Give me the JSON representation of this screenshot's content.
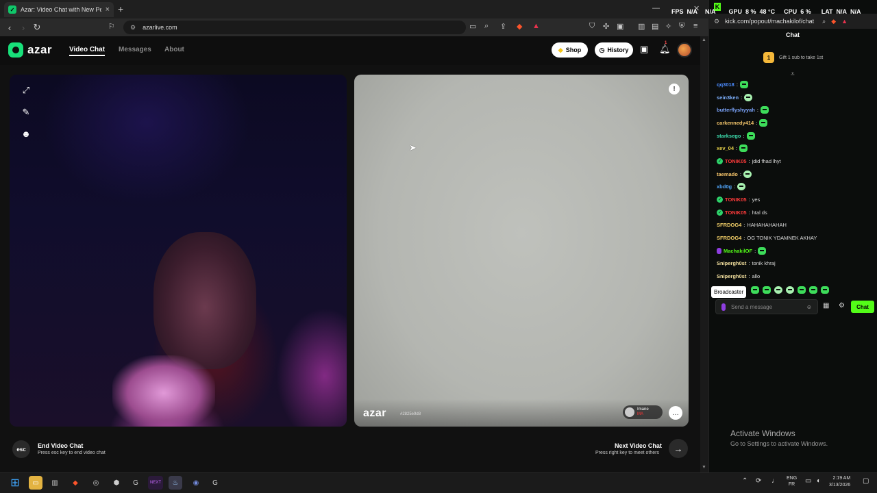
{
  "browser": {
    "tab_title": "Azar: Video Chat with New Pe",
    "url": "azarlive.com"
  },
  "azar": {
    "brand": "azar",
    "nav": [
      "Video Chat",
      "Messages",
      "About"
    ],
    "shop_label": "Shop",
    "history_label": "History",
    "notification_count": "1",
    "watermark": "azar",
    "watermark_id": "#2825e9d8",
    "peer_name": "Imane",
    "peer_country": "MA",
    "end_title": "End Video Chat",
    "end_sub": "Press esc key to end video chat",
    "esc_label": "esc",
    "next_title": "Next Video Chat",
    "next_sub": "Press right key to meet others"
  },
  "overlay": {
    "fps_label": "FPS",
    "fps_val": "N/A",
    "gpu_label": "GPU",
    "gpu_pct": "8 %",
    "gpu_temp": "48 °C",
    "cpu_label": "CPU",
    "cpu_pct": "6 %",
    "lat_label": "LAT",
    "lat_val1": "N/A",
    "lat_val2": "N/A"
  },
  "kick": {
    "url": "kick.com/popout/machakilof/chat",
    "chat_title": "Chat",
    "gift_text": "Gift 1 sub to take 1st",
    "gift_rank": "1",
    "messages": [
      {
        "user": "qq3018",
        "color": "#4d8cff",
        "badge": "",
        "text": "",
        "emote": "green"
      },
      {
        "user": "sein3ken",
        "color": "#7fb2ff",
        "badge": "",
        "text": "",
        "emote": "face"
      },
      {
        "user": "butterflyshyyah",
        "color": "#7da6ff",
        "badge": "",
        "text": "",
        "emote": "green"
      },
      {
        "user": "carkennedy414",
        "color": "#f2c46a",
        "badge": "",
        "text": "",
        "emote": "green"
      },
      {
        "user": "starksego",
        "color": "#3ee0b0",
        "badge": "",
        "text": "",
        "emote": "green"
      },
      {
        "user": "xev_04",
        "color": "#e8d34a",
        "badge": "",
        "text": "",
        "emote": "green"
      },
      {
        "user": "TONIK05",
        "color": "#ff3b3b",
        "badge": "check",
        "text": "jdid fhad lhyt",
        "emote": ""
      },
      {
        "user": "taemado",
        "color": "#f7c56b",
        "badge": "",
        "text": "",
        "emote": "face"
      },
      {
        "user": "xbd0g",
        "color": "#52a8ff",
        "badge": "",
        "text": "",
        "emote": "face"
      },
      {
        "user": "TONIK05",
        "color": "#ff3b3b",
        "badge": "check",
        "text": "yes",
        "emote": ""
      },
      {
        "user": "TONIK05",
        "color": "#ff3b3b",
        "badge": "check",
        "text": "htal ds",
        "emote": ""
      },
      {
        "user": "SFRDOG4",
        "color": "#f7d36a",
        "badge": "",
        "text": "HAHAHAHAHAH",
        "emote": ""
      },
      {
        "user": "SFRDOG4",
        "color": "#f7d36a",
        "badge": "",
        "text": "OG TONIK YDAMNEK AKHAY",
        "emote": ""
      },
      {
        "user": "MachakilOF",
        "color": "#53fc18",
        "badge": "mic",
        "text": "",
        "emote": "green"
      },
      {
        "user": "Snipergh0st",
        "color": "#f7e3a1",
        "badge": "",
        "text": "tonik khraj",
        "emote": ""
      },
      {
        "user": "Snipergh0st",
        "color": "#f7e3a1",
        "badge": "",
        "text": "allo",
        "emote": ""
      }
    ],
    "tooltip": "Broadcaster",
    "input_placeholder": "Send a message",
    "send_label": "Chat",
    "activate_title": "Activate Windows",
    "activate_sub": "Go to Settings to activate Windows."
  },
  "taskbar": {
    "lang_top": "ENG",
    "lang_bottom": "FR",
    "time": "2:19 AM",
    "date": "3/13/2026",
    "app_label": "NEXT"
  }
}
